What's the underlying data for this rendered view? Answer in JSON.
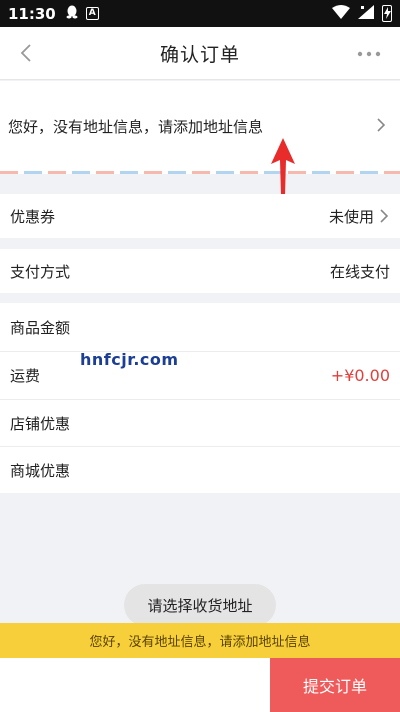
{
  "status_bar": {
    "time": "11:30",
    "app_badge": "A"
  },
  "nav": {
    "title": "确认订单"
  },
  "address": {
    "prompt": "您好，没有地址信息，请添加地址信息"
  },
  "coupon": {
    "label": "优惠券",
    "value": "未使用"
  },
  "payment": {
    "label": "支付方式",
    "value": "在线支付"
  },
  "summary": {
    "goods_amount_label": "商品金额",
    "shipping_label": "运费",
    "shipping_value": "+¥0.00",
    "store_discount_label": "店铺优惠",
    "mall_discount_label": "商城优惠"
  },
  "watermark": "hnfcjr.com",
  "toast": "请选择收货地址",
  "notice": "您好，没有地址信息，请添加地址信息",
  "bottom": {
    "submit_label": "提交订单"
  },
  "colors": {
    "accent_red": "#ef5b5b",
    "notice_yellow": "#f6cf3a",
    "price_red": "#e0403c"
  }
}
